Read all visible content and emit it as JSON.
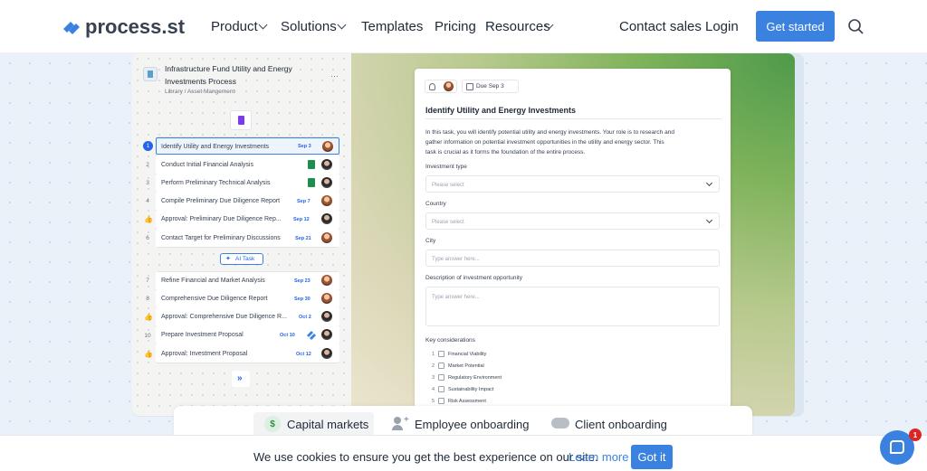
{
  "nav": {
    "logo_text": "process.st",
    "items": [
      "Product",
      "Solutions",
      "Templates",
      "Pricing",
      "Resources"
    ],
    "contact_sales": "Contact sales",
    "login": "Login",
    "get_started": "Get started"
  },
  "template": {
    "title_line1": "Infrastructure Fund Utility and Energy",
    "title_line2": "Investments Process",
    "breadcrumb": "Library / Asset Mangement",
    "tasks": [
      {
        "num": "1",
        "label": "Identify Utility and Energy Investments",
        "date": "Sep 3"
      },
      {
        "num": "2",
        "label": "Conduct Initial Financial Analysis",
        "date": ""
      },
      {
        "num": "3",
        "label": "Perform Preliminary Technical Analysis",
        "date": ""
      },
      {
        "num": "4",
        "label": "Compile Preliminary Due Diligence Report",
        "date": "Sep 7"
      },
      {
        "num": "",
        "label": "Approval: Preliminary Due Diligence Rep...",
        "date": "Sep 12"
      },
      {
        "num": "6",
        "label": "Contact Target for Preliminary Discussions",
        "date": "Sep 21"
      }
    ],
    "ai_task": "AI Task",
    "tasks2": [
      {
        "num": "7",
        "label": "Refine Financial and Market Analysis",
        "date": "Sep 23"
      },
      {
        "num": "8",
        "label": "Comprehensive Due Diligence Report",
        "date": "Sep 30"
      },
      {
        "num": "",
        "label": "Approval: Comprehensive Due Diligence R...",
        "date": "Oct 2"
      },
      {
        "num": "10",
        "label": "Prepare Investment Proposal",
        "date": "Oct 10"
      },
      {
        "num": "",
        "label": "Approval: Investment Proposal",
        "date": "Oct 12"
      }
    ]
  },
  "form": {
    "due": "Due Sep 3",
    "title": "Identify Utility and Energy Investments",
    "desc1": "In this task, you will identify potential utility and energy investments. Your role is to research and",
    "desc2": "gather information on potential investment opportunities in the utility and energy sector. This",
    "desc3": "task is crucial as it forms the foundation of the entire process.",
    "investment_type_label": "Investment type",
    "investment_type_ph": "Please select",
    "country_label": "Country",
    "country_ph": "Please select",
    "city_label": "City",
    "city_ph": "Type answer here...",
    "desc_label": "Description of investment opportunity",
    "desc_ph": "Type answer here...",
    "key_label": "Key considerations",
    "considerations": [
      {
        "num": "1",
        "label": "Financial Viability"
      },
      {
        "num": "2",
        "label": "Market Potential"
      },
      {
        "num": "3",
        "label": "Regulatory Environment"
      },
      {
        "num": "4",
        "label": "Sustainability Impact"
      },
      {
        "num": "5",
        "label": "Risk Assessment"
      }
    ]
  },
  "tabs": [
    "Capital markets",
    "Employee onboarding",
    "Client onboarding"
  ],
  "cookie": {
    "text": "We use cookies to ensure you get the best experience on our site.",
    "learn_more": "Learn more",
    "got_it": "Got it"
  },
  "chat": {
    "badge": "1"
  },
  "colors": {
    "accent": "#3b82e0",
    "date": "#2563eb",
    "badge": "#dc2626"
  }
}
